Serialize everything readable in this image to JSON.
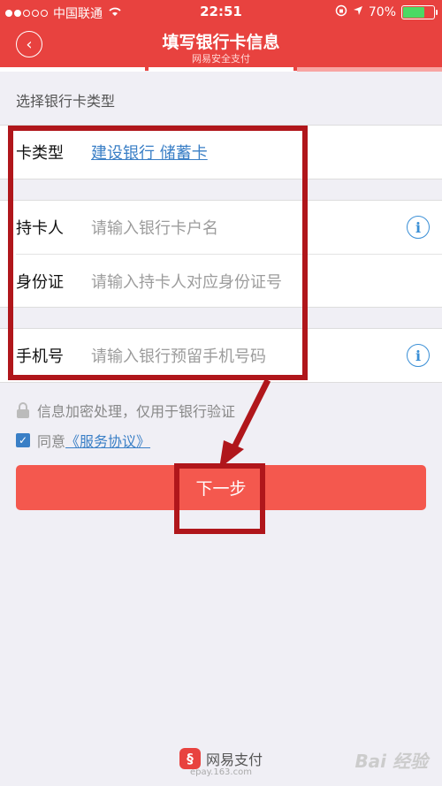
{
  "status_bar": {
    "carrier": "中国联通",
    "time": "22:51",
    "battery": "70%",
    "battery_level": 0.7
  },
  "header": {
    "title": "填写银行卡信息",
    "subtitle": "网易安全支付",
    "progress_steps": 3,
    "progress_done": 2
  },
  "form": {
    "section_label": "选择银行卡类型",
    "card_type": {
      "label": "卡类型",
      "value": "建设银行 储蓄卡"
    },
    "holder": {
      "label": "持卡人",
      "placeholder": "请输入银行卡户名"
    },
    "id_card": {
      "label": "身份证",
      "placeholder": "请输入持卡人对应身份证号"
    },
    "phone": {
      "label": "手机号",
      "placeholder": "请输入银行预留手机号码"
    }
  },
  "notes": {
    "security": "信息加密处理，仅用于银行验证",
    "agree_prefix": "同意",
    "agree_link": "《服务协议》"
  },
  "actions": {
    "next": "下一步"
  },
  "footer": {
    "brand": "网易支付",
    "url": "epay.163.com",
    "watermark": "Bai 经验"
  },
  "colors": {
    "brand_red": "#e8423f",
    "button": "#f4584e",
    "link": "#3a7fc6",
    "annotation": "#b0161b"
  }
}
